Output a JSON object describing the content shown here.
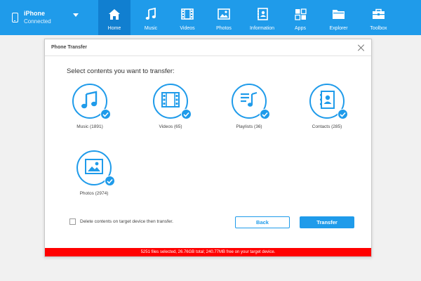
{
  "device": {
    "name": "iPhone",
    "status": "Connected"
  },
  "tabs": [
    {
      "label": "Home",
      "icon": "home-icon",
      "active": true
    },
    {
      "label": "Music",
      "icon": "music-icon"
    },
    {
      "label": "Videos",
      "icon": "film-icon"
    },
    {
      "label": "Photos",
      "icon": "photo-icon"
    },
    {
      "label": "Information",
      "icon": "contacts-icon"
    },
    {
      "label": "Apps",
      "icon": "apps-icon"
    },
    {
      "label": "Explorer",
      "icon": "folder-icon"
    },
    {
      "label": "Toolbox",
      "icon": "toolbox-icon"
    }
  ],
  "dialog": {
    "title": "Phone Transfer",
    "prompt": "Select contents you want to transfer:",
    "items": [
      {
        "label": "Music (1891)",
        "icon": "music-icon",
        "checked": true
      },
      {
        "label": "Videos (65)",
        "icon": "film-icon",
        "checked": true
      },
      {
        "label": "Playlists (36)",
        "icon": "playlist-icon",
        "checked": true
      },
      {
        "label": "Contacts (285)",
        "icon": "contacts-icon",
        "checked": true
      },
      {
        "label": "Photos (2974)",
        "icon": "photo-icon",
        "checked": true
      }
    ],
    "delete_option": {
      "label": "Delete contents on target device then transfer.",
      "checked": false
    },
    "back_label": "Back",
    "transfer_label": "Transfer",
    "status": "5251 files selected, 26.76GB total; 240.77MB free on your target device."
  },
  "colors": {
    "accent": "#1f9bea",
    "active_tab": "#117fd0",
    "status_bar": "#ff0000"
  }
}
